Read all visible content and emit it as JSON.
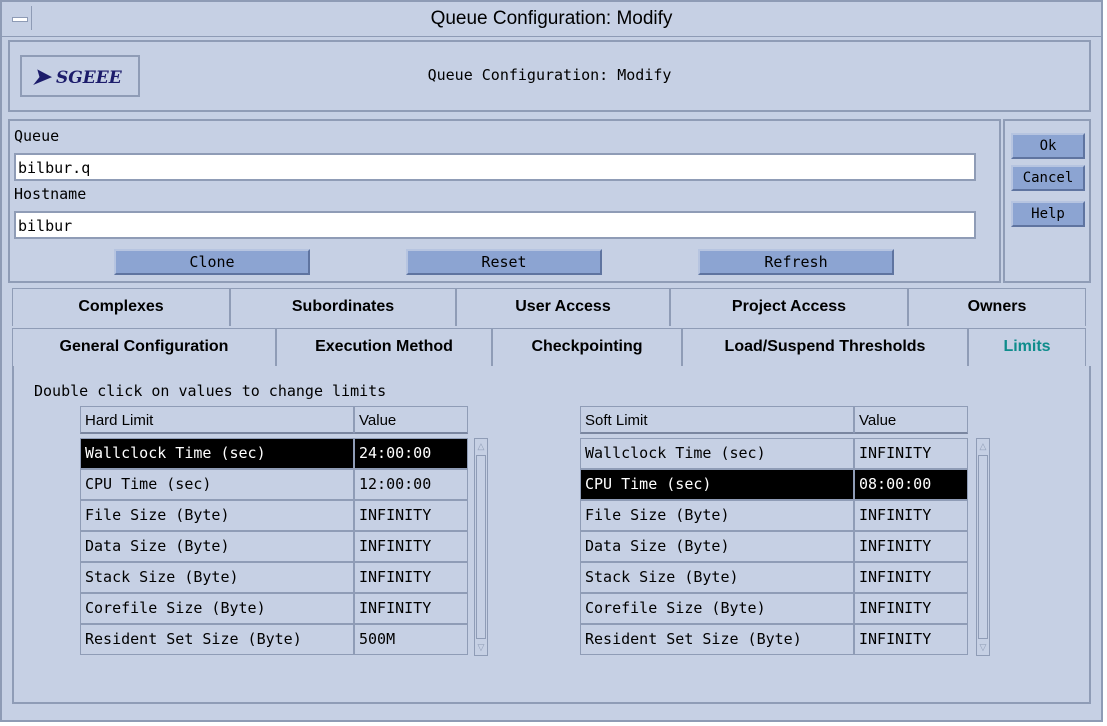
{
  "window": {
    "title": "Queue Configuration: Modify"
  },
  "header": {
    "logo_text": "SGEEE",
    "title": "Queue Configuration: Modify"
  },
  "form": {
    "queue_label": "Queue",
    "queue_value": "bilbur.q",
    "hostname_label": "Hostname",
    "hostname_value": "bilbur",
    "clone_label": "Clone",
    "reset_label": "Reset",
    "refresh_label": "Refresh"
  },
  "side_buttons": {
    "ok": "Ok",
    "cancel": "Cancel",
    "help": "Help"
  },
  "tabs_row1": [
    "Complexes",
    "Subordinates",
    "User Access",
    "Project Access",
    "Owners"
  ],
  "tabs_row2": [
    "General Configuration",
    "Execution Method",
    "Checkpointing",
    "Load/Suspend Thresholds",
    "Limits"
  ],
  "active_tab": "Limits",
  "limits": {
    "hint": "Double click on values to change limits",
    "hard": {
      "col_name": "Hard Limit",
      "col_value": "Value",
      "rows": [
        {
          "name": "Wallclock Time (sec)",
          "value": "24:00:00"
        },
        {
          "name": "CPU Time (sec)",
          "value": "12:00:00"
        },
        {
          "name": "File Size (Byte)",
          "value": "INFINITY"
        },
        {
          "name": "Data Size (Byte)",
          "value": "INFINITY"
        },
        {
          "name": "Stack Size (Byte)",
          "value": "INFINITY"
        },
        {
          "name": "Corefile Size (Byte)",
          "value": "INFINITY"
        },
        {
          "name": "Resident Set Size (Byte)",
          "value": "500M"
        }
      ]
    },
    "soft": {
      "col_name": "Soft Limit",
      "col_value": "Value",
      "rows": [
        {
          "name": "Wallclock Time (sec)",
          "value": "INFINITY"
        },
        {
          "name": "CPU Time (sec)",
          "value": "08:00:00"
        },
        {
          "name": "File Size (Byte)",
          "value": "INFINITY"
        },
        {
          "name": "Data Size (Byte)",
          "value": "INFINITY"
        },
        {
          "name": "Stack Size (Byte)",
          "value": "INFINITY"
        },
        {
          "name": "Corefile Size (Byte)",
          "value": "INFINITY"
        },
        {
          "name": "Resident Set Size (Byte)",
          "value": "INFINITY"
        }
      ]
    }
  },
  "colors": {
    "window_bg": "#c6d0e4",
    "button_bg": "#8ca4d2",
    "active_tab": "#0e8c8c",
    "selection": "#000000"
  }
}
